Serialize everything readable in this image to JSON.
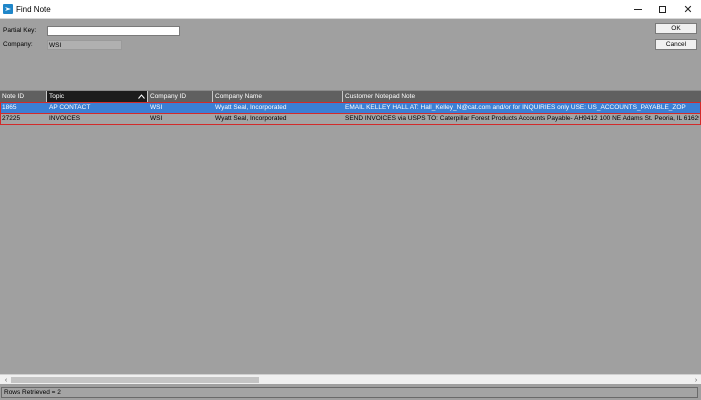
{
  "window": {
    "title": "Find Note",
    "app_icon": "app-logo-icon",
    "controls": {
      "minimize": "minimize-icon",
      "maximize": "maximize-icon",
      "close": "close-icon",
      "close_glyph": "✕"
    }
  },
  "form": {
    "partial_key_label": "Partial Key:",
    "partial_key_value": "",
    "company_label": "Company:",
    "company_value": "WSI"
  },
  "buttons": {
    "ok_label": "OK",
    "cancel_label": "Cancel"
  },
  "grid": {
    "columns": [
      {
        "label": "Note ID"
      },
      {
        "label": "Topic",
        "sorted": "ascending"
      },
      {
        "label": "Company ID"
      },
      {
        "label": "Company Name"
      },
      {
        "label": "Customer Notepad Note"
      }
    ],
    "rows": [
      {
        "note_id": "1865",
        "topic": "AP CONTACT",
        "company_id": "WSI",
        "company_name": "Wyatt Seal, Incorporated",
        "note": "EMAIL KELLEY HALL AT: Hall_Kelley_N@cat.com and/or  for INQUIRIES only USE: US_ACCOUNTS_PAYABLE_ZOP",
        "selected": true
      },
      {
        "note_id": "27225",
        "topic": "INVOICES",
        "company_id": "WSI",
        "company_name": "Wyatt Seal, Incorporated",
        "note": "SEND INVOICES via USPS TO: Caterpillar Forest Products Accounts Payable- AH9412 100 NE Adams St. Peoria, IL 61629",
        "selected": false
      }
    ],
    "highlight_color": "#d22a2a",
    "selection_color": "#3b7fd4"
  },
  "scrollbar": {
    "left_glyph": "‹",
    "right_glyph": "›"
  },
  "status": {
    "text": "Rows Retrieved = 2"
  }
}
